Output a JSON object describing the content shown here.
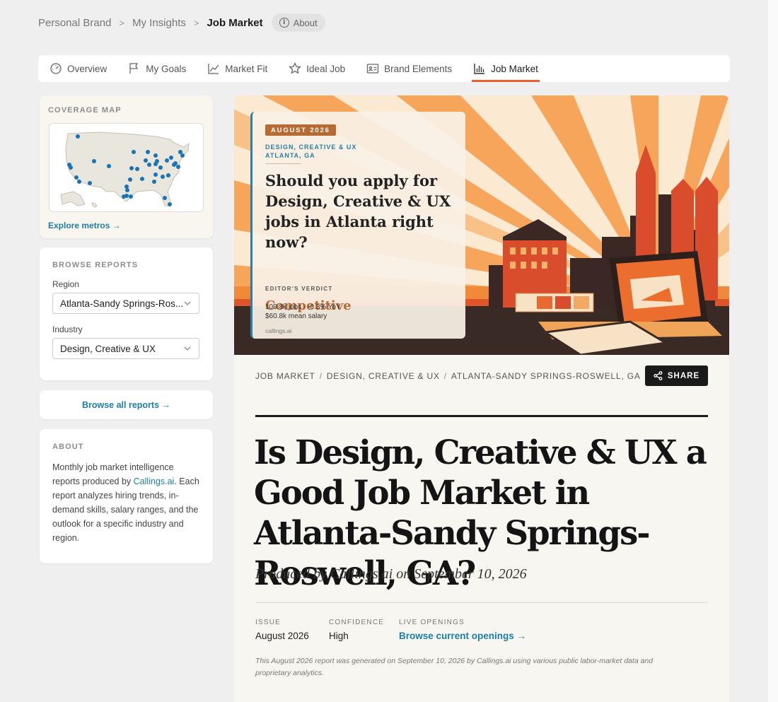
{
  "breadcrumb": {
    "items": [
      "Personal Brand",
      "My Insights"
    ],
    "current": "Job Market",
    "about_label": "About"
  },
  "tabs": [
    {
      "label": "Overview",
      "icon": "gauge-icon"
    },
    {
      "label": "My Goals",
      "icon": "flag-icon"
    },
    {
      "label": "Market Fit",
      "icon": "line-chart-icon"
    },
    {
      "label": "Ideal Job",
      "icon": "star-icon"
    },
    {
      "label": "Brand Elements",
      "icon": "id-card-icon"
    },
    {
      "label": "Job Market",
      "icon": "bar-chart-icon",
      "active": true
    }
  ],
  "sidebar": {
    "coverage": {
      "label": "COVERAGE MAP",
      "link": "Explore metros →"
    },
    "browse": {
      "label": "BROWSE REPORTS",
      "region_label": "Region",
      "region_value": "Atlanta-Sandy Springs-Ros...",
      "industry_label": "Industry",
      "industry_value": "Design, Creative & UX"
    },
    "browse_all": "Browse all reports →",
    "about": {
      "label": "ABOUT",
      "text_before": "Monthly job market intelligence reports produced by ",
      "link": "Callings.ai",
      "text_after": ". Each report analyzes hiring trends, in-demand skills, salary ranges, and the outlook for a specific industry and region."
    }
  },
  "hero": {
    "badge": "AUGUST 2026",
    "category_line1": "DESIGN, CREATIVE & UX",
    "category_line2": "ATLANTA, GA",
    "question": "Should you apply for Design, Creative & UX jobs in Atlanta right now?",
    "verdict_label": "EDITOR'S VERDICT",
    "verdict": "Competitive",
    "stat1": "109.8k jobs · -0.3% YoY",
    "stat2": "$60.8k mean salary",
    "source": "callings.ai"
  },
  "article": {
    "crumbs": [
      "JOB MARKET",
      "DESIGN, CREATIVE & UX",
      "ATLANTA-SANDY SPRINGS-ROSWELL, GA"
    ],
    "share": "SHARE",
    "title": "Is Design, Creative & UX a Good Job Market in Atlanta-Sandy Springs-Roswell, GA?",
    "byline": "Produced by Callings.ai on September 10, 2026",
    "meta": [
      {
        "key": "ISSUE",
        "value": "August 2026"
      },
      {
        "key": "CONFIDENCE",
        "value": "High"
      },
      {
        "key": "LIVE OPENINGS",
        "value": "Browse current openings →"
      }
    ],
    "disclaimer": "This August 2026 report was generated on September 10, 2026 by Callings.ai using various public labor-market data and proprietary analytics."
  },
  "colors": {
    "accent": "#e8612c",
    "link": "#1d7ea8",
    "badge": "#b76a32",
    "map_dot": "#1a73b5"
  }
}
